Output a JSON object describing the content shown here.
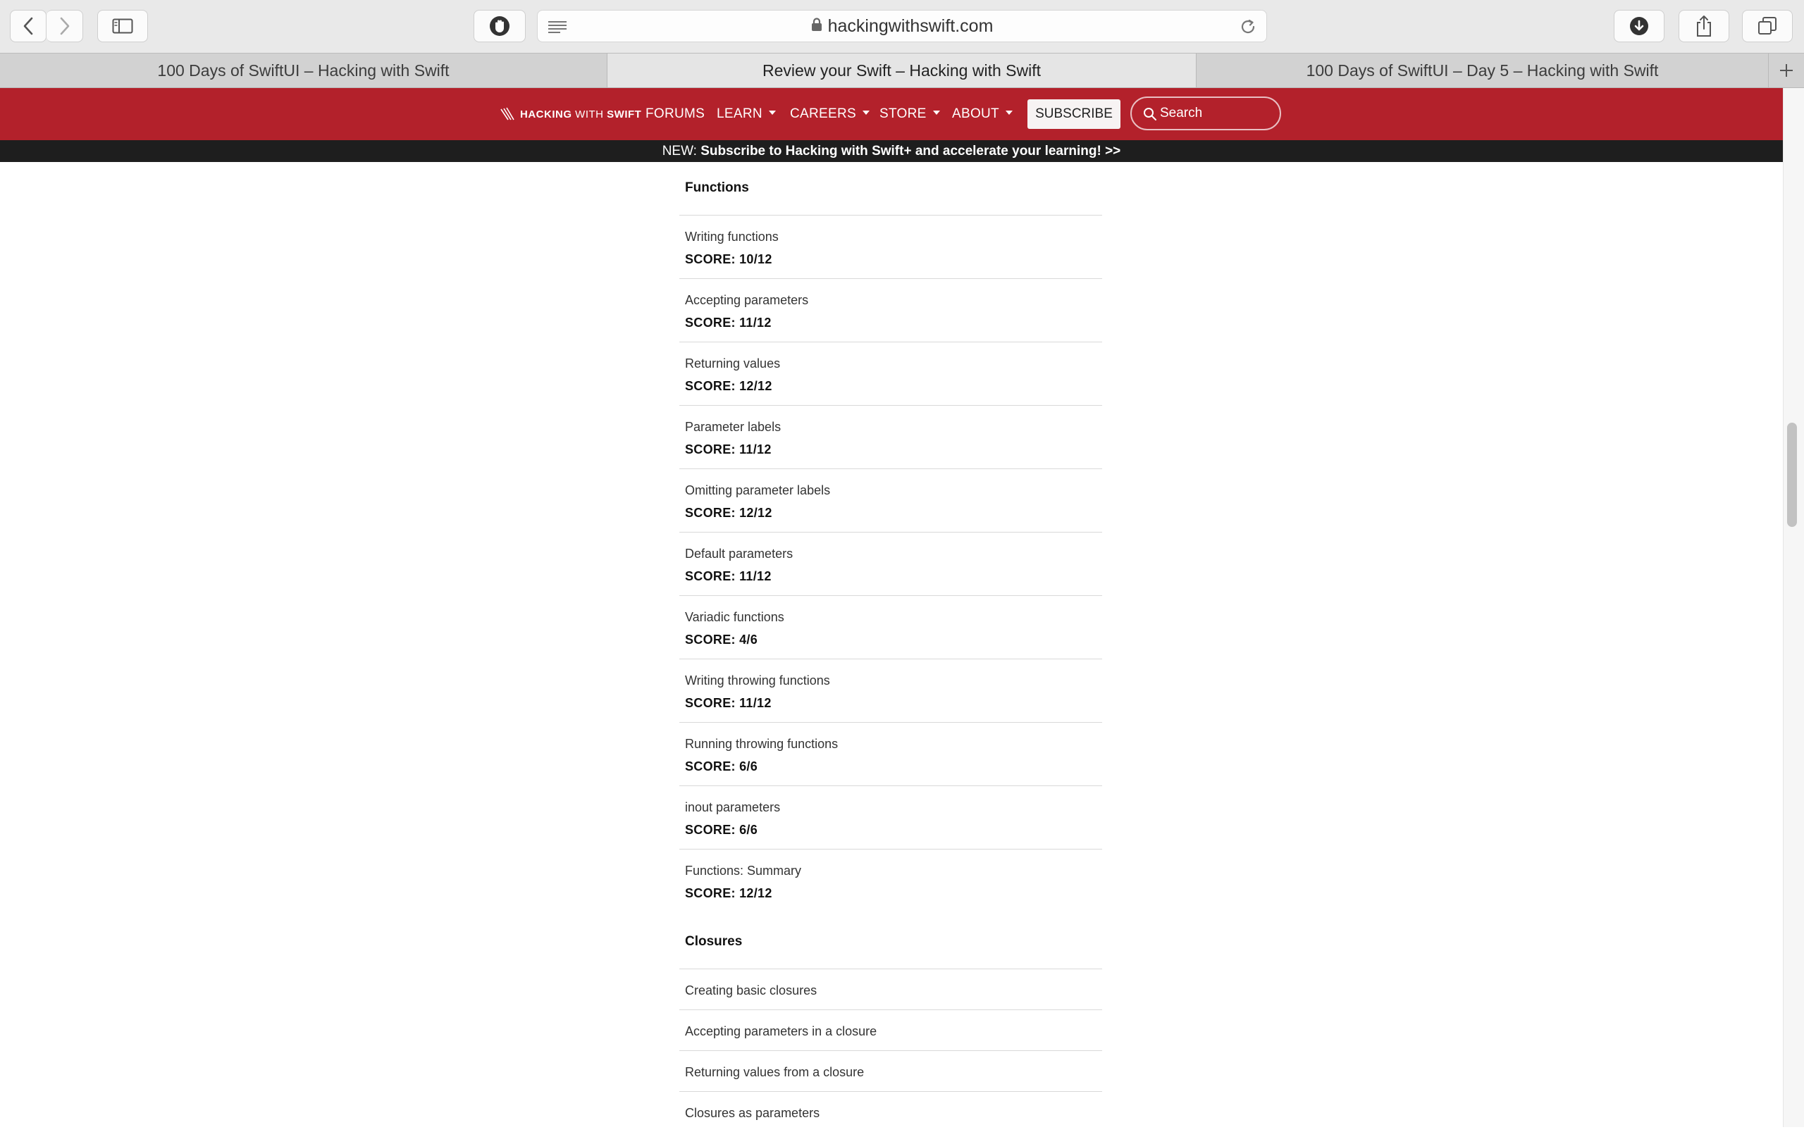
{
  "browser": {
    "url": "hackingwithswift.com",
    "tabs": [
      {
        "title": "100 Days of SwiftUI – Hacking with Swift",
        "active": false
      },
      {
        "title": "Review your Swift – Hacking with Swift",
        "active": true
      },
      {
        "title": "100 Days of SwiftUI – Day 5 – Hacking with Swift",
        "active": false
      }
    ]
  },
  "nav": {
    "logo_main": "HACKING",
    "logo_with": "WITH",
    "logo_swift": "SWIFT",
    "forums": "FORUMS",
    "learn": "LEARN",
    "careers": "CAREERS",
    "store": "STORE",
    "about": "ABOUT",
    "subscribe": "SUBSCRIBE",
    "search_placeholder": "Search"
  },
  "promo": {
    "prefix": "NEW: ",
    "text": "Subscribe to Hacking with Swift+ and accelerate your learning! >>"
  },
  "sections": [
    {
      "title": "Functions",
      "items": [
        {
          "name": "Writing functions",
          "score": "SCORE: 10/12"
        },
        {
          "name": "Accepting parameters",
          "score": "SCORE: 11/12"
        },
        {
          "name": "Returning values",
          "score": "SCORE: 12/12"
        },
        {
          "name": "Parameter labels",
          "score": "SCORE: 11/12"
        },
        {
          "name": "Omitting parameter labels",
          "score": "SCORE: 12/12"
        },
        {
          "name": "Default parameters",
          "score": "SCORE: 11/12"
        },
        {
          "name": "Variadic functions",
          "score": "SCORE: 4/6"
        },
        {
          "name": "Writing throwing functions",
          "score": "SCORE: 11/12"
        },
        {
          "name": "Running throwing functions",
          "score": "SCORE: 6/6"
        },
        {
          "name": "inout parameters",
          "score": "SCORE: 6/6"
        },
        {
          "name": "Functions: Summary",
          "score": "SCORE: 12/12"
        }
      ]
    },
    {
      "title": "Closures",
      "items": [
        {
          "name": "Creating basic closures"
        },
        {
          "name": "Accepting parameters in a closure"
        },
        {
          "name": "Returning values from a closure"
        },
        {
          "name": "Closures as parameters"
        }
      ]
    }
  ],
  "colors": {
    "brand_red": "#b3212b",
    "promo_bg": "#1e1e1e"
  }
}
